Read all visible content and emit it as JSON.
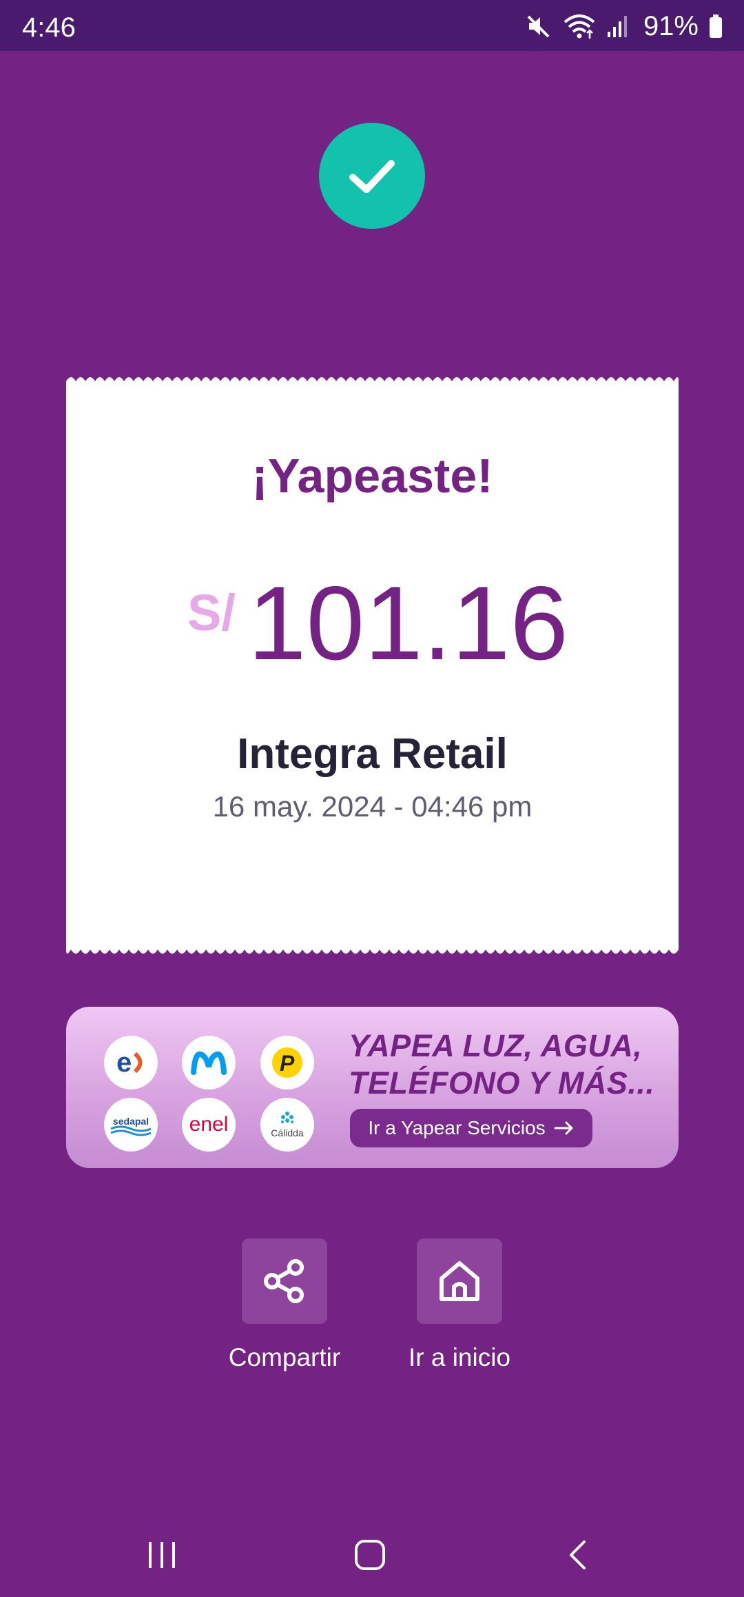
{
  "status_bar": {
    "time": "4:46",
    "battery": "91%",
    "icons": [
      "mute-icon",
      "wifi-icon",
      "signal-icon",
      "battery-icon"
    ]
  },
  "success_icon": "check-icon",
  "receipt": {
    "title": "¡Yapeaste!",
    "currency": "S/",
    "amount": "101.16",
    "merchant": "Integra Retail",
    "datetime": "16 may. 2024 - 04:46 pm"
  },
  "banner": {
    "headline_line1": "YAPEA LUZ, AGUA,",
    "headline_line2": "TELÉFONO Y MÁS...",
    "cta_label": "Ir a Yapear Servicios",
    "logos": {
      "sedapal": "sedapal",
      "enel": "enel",
      "calidda": "Cálidda"
    }
  },
  "actions": {
    "share_label": "Compartir",
    "home_label": "Ir a inicio"
  },
  "nav": {
    "icons": [
      "recent-apps-icon",
      "home-icon",
      "back-icon"
    ]
  },
  "colors": {
    "background": "#742283",
    "status_bar": "#4a1a6e",
    "accent_green": "#12c2ac",
    "brand_purple": "#742283"
  }
}
